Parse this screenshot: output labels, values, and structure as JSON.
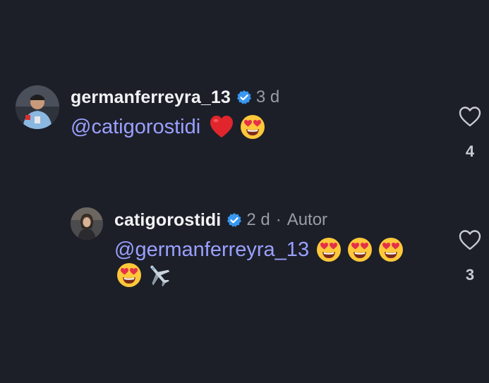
{
  "comments": [
    {
      "username": "germanferreyra_13",
      "time": "3 d",
      "mention": "@catigorostidi",
      "like_count": "4",
      "emojis": [
        "red-heart",
        "heart-eyes-face"
      ]
    },
    {
      "username": "catigorostidi",
      "time": "2 d",
      "separator": "·",
      "author_label": "Autor",
      "mention": "@germanferreyra_13",
      "like_count": "3",
      "emojis": [
        "heart-eyes-face",
        "heart-eyes-face",
        "heart-eyes-face",
        "heart-eyes-face",
        "airplane"
      ]
    }
  ],
  "colors": {
    "background": "#1c1f28",
    "username": "#f2f3f5",
    "meta": "#9a9ca4",
    "mention": "#9aa0ff",
    "verified": "#3897f0"
  }
}
